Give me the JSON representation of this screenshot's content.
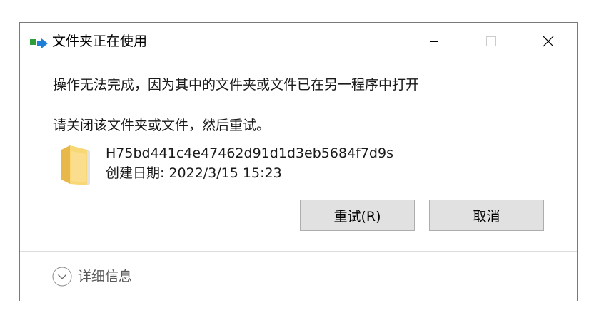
{
  "window": {
    "title": "文件夹正在使用",
    "icon": "folder-move-icon",
    "controls": {
      "minimize": "minimize-icon",
      "maximize": "maximize-icon",
      "close": "close-icon"
    }
  },
  "messages": {
    "primary": "操作无法完成，因为其中的文件夹或文件已在另一程序中打开",
    "secondary": "请关闭该文件夹或文件，然后重试。"
  },
  "item": {
    "icon": "folder-icon",
    "name": "H75bd441c4e47462d91d1d3eb5684f7d9s",
    "created": "创建日期: 2022/3/15 15:23"
  },
  "buttons": {
    "retry_label": "重试(R)",
    "cancel_label": "取消"
  },
  "footer": {
    "details_label": "详细信息",
    "details_icon": "chevron-down-icon"
  },
  "colors": {
    "button_bg": "#e1e1e1",
    "button_border": "#adadad",
    "folder_yellow": "#f8d775",
    "icon_green": "#2e9e3a",
    "icon_blue": "#1e7fd6"
  }
}
